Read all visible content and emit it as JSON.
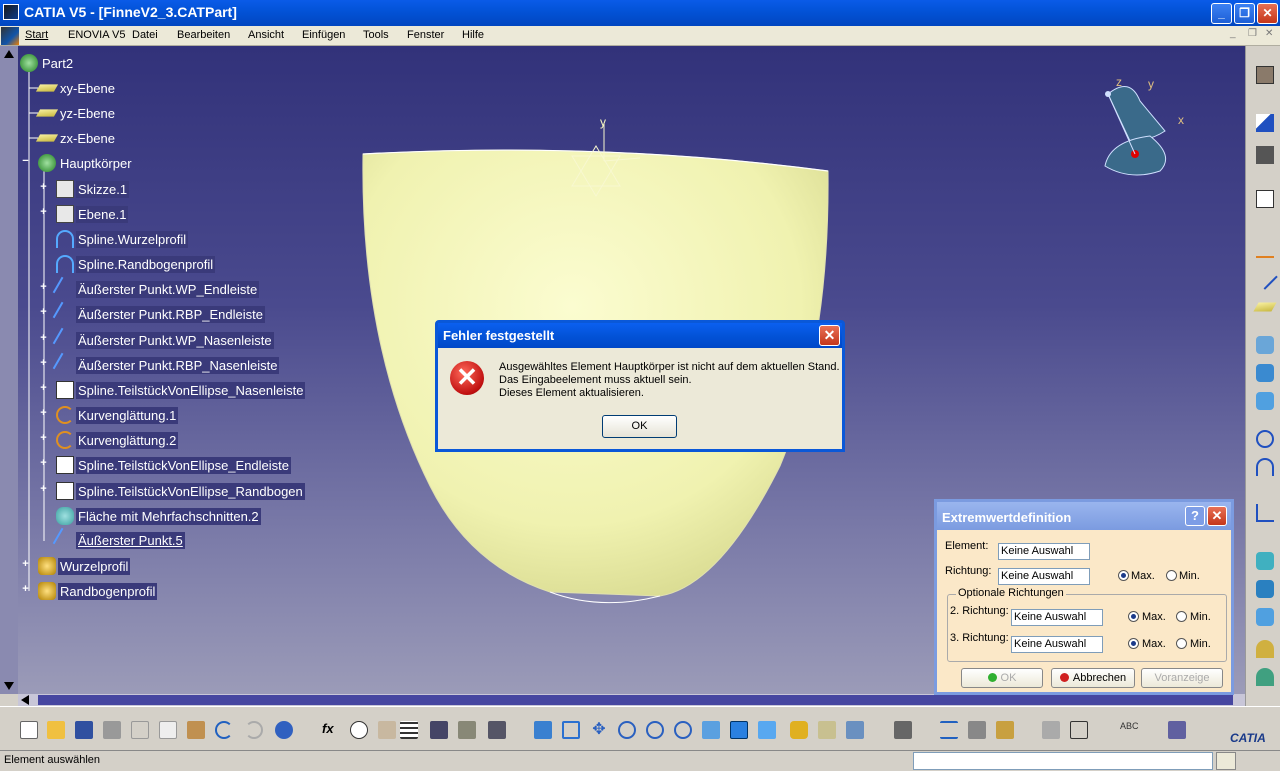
{
  "window": {
    "title": "CATIA V5 - [FinneV2_3.CATPart]",
    "minimize_glyph": "_",
    "restore_glyph": "❐",
    "close_glyph": "✕"
  },
  "menu": {
    "items": [
      "Start",
      "ENOVIA V5",
      "Datei",
      "Bearbeiten",
      "Ansicht",
      "Einfügen",
      "Tools",
      "Fenster",
      "Hilfe"
    ]
  },
  "tree": {
    "root": "Part2",
    "nodes": [
      {
        "label": "xy-Ebene",
        "icon": "plane-icon"
      },
      {
        "label": "yz-Ebene",
        "icon": "plane-icon"
      },
      {
        "label": "zx-Ebene",
        "icon": "plane-icon"
      },
      {
        "label": "Hauptkörper",
        "icon": "body-icon"
      },
      {
        "label": "Skizze.1",
        "icon": "sketch-icon"
      },
      {
        "label": "Ebene.1",
        "icon": "plane-icon"
      },
      {
        "label": "Spline.Wurzelprofil",
        "icon": "spline-icon"
      },
      {
        "label": "Spline.Randbogenprofil",
        "icon": "spline-icon"
      },
      {
        "label": "Äußerster Punkt.WP_Endleiste",
        "icon": "extremum-icon"
      },
      {
        "label": "Äußerster Punkt.RBP_Endleiste",
        "icon": "extremum-icon"
      },
      {
        "label": "Äußerster Punkt.WP_Nasenleiste",
        "icon": "extremum-icon"
      },
      {
        "label": "Äußerster Punkt.RBP_Nasenleiste",
        "icon": "extremum-icon"
      },
      {
        "label": "Spline.TeilstückVonEllipse_Nasenleiste",
        "icon": "spline-checked-icon"
      },
      {
        "label": "Kurvenglättung.1",
        "icon": "curve-smooth-icon"
      },
      {
        "label": "Kurvenglättung.2",
        "icon": "curve-smooth-icon"
      },
      {
        "label": "Spline.TeilstückVonEllipse_Endleiste",
        "icon": "spline-checked-icon"
      },
      {
        "label": "Spline.TeilstückVonEllipse_Randbogen",
        "icon": "spline-checked-icon"
      },
      {
        "label": "Fläche mit Mehrfachschnitten.2",
        "icon": "multisection-surface-icon"
      },
      {
        "label": "Äußerster Punkt.5",
        "icon": "extremum-icon"
      },
      {
        "label": "Wurzelprofil",
        "icon": "geometric-set-icon"
      },
      {
        "label": "Randbogenprofil",
        "icon": "geometric-set-icon"
      }
    ]
  },
  "compass": {
    "x": "x",
    "y": "y",
    "z": "z"
  },
  "axis_y_label": "y",
  "error_dialog": {
    "title": "Fehler festgestellt",
    "line1": "Ausgewähltes Element Hauptkörper ist nicht auf dem aktuellen Stand.",
    "line2": "Das Eingabeelement muss aktuell sein.",
    "line3": "Dieses Element aktualisieren.",
    "ok": "OK",
    "icon": "error-icon",
    "close": "✕"
  },
  "extremum_dialog": {
    "title": "Extremwertdefinition",
    "help": "?",
    "close": "✕",
    "element_label": "Element:",
    "element_value": "Keine Auswahl",
    "direction_label": "Richtung:",
    "direction_value": "Keine Auswahl",
    "max": "Max.",
    "min": "Min.",
    "optional_group": "Optionale Richtungen",
    "dir2_label": "2. Richtung:",
    "dir2_value": "Keine Auswahl",
    "dir3_label": "3. Richtung:",
    "dir3_value": "Keine Auswahl",
    "ok": "OK",
    "cancel": "Abbrechen",
    "preview": "Voranzeige"
  },
  "status": {
    "text": "Element auswählen",
    "command_value": ""
  },
  "brand": "CATIA",
  "colors": {
    "surface": "#f2f3b4",
    "viewport_top": "#32327a",
    "viewport_bottom": "#9b9bb8",
    "title_bar": "#0353d8"
  }
}
